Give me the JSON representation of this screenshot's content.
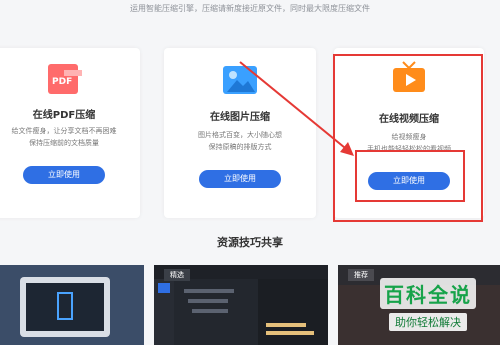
{
  "top_note": "运用智能压缩引擎，压缩请新度接近原文件，同时最大限度压缩文件",
  "cards": [
    {
      "title": "在线PDF压缩",
      "desc_line1": "给文件瘦身，让分享文档不再困难",
      "desc_line2": "保持压缩前的文档质量",
      "button": "立即使用",
      "icon": "pdf-icon"
    },
    {
      "title": "在线图片压缩",
      "desc_line1": "图片格式百变，大小随心想",
      "desc_line2": "保持原稿的排版方式",
      "button": "立即使用",
      "icon": "image-icon"
    },
    {
      "title": "在线视频压缩",
      "desc_line1": "给视频瘦身",
      "desc_line2": "手机也能轻轻松松的看视频",
      "button": "立即使用",
      "icon": "tv-icon"
    }
  ],
  "section_title": "资源技巧共享",
  "thumbs": [
    {
      "tag": ""
    },
    {
      "tag": "精选"
    },
    {
      "tag": "推荐"
    }
  ],
  "watermark": {
    "title": "百科全说",
    "subtitle": "助你轻松解决"
  },
  "colors": {
    "accent": "#2f6fe4",
    "highlight": "#e53935",
    "pdf": "#ff6b6b",
    "image": "#3aa0ff",
    "video": "#ff8c1a"
  }
}
